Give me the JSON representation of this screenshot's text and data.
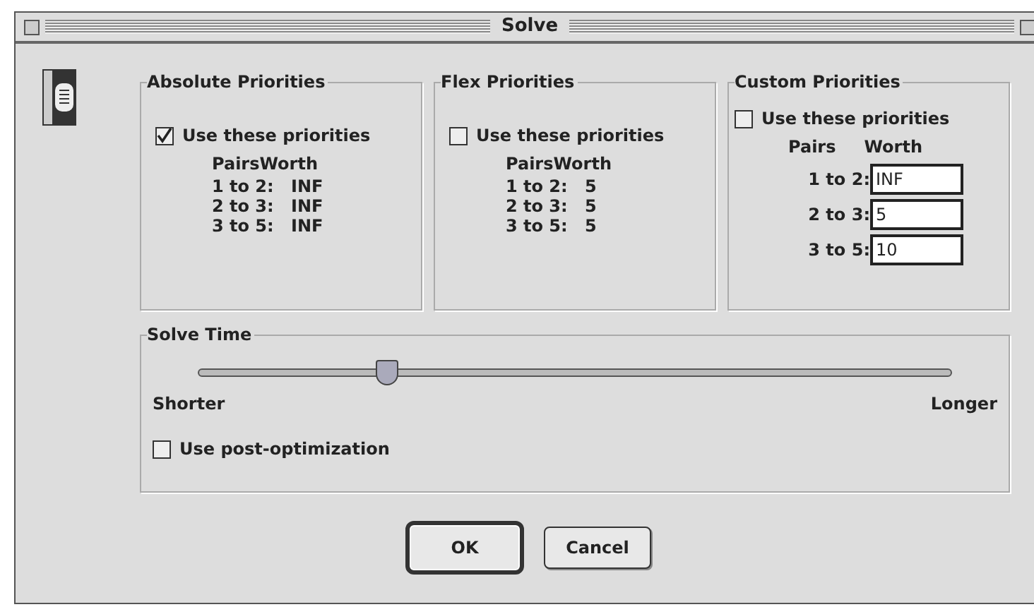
{
  "window": {
    "title": "Solve"
  },
  "groups": [
    {
      "kind": "fixed",
      "title": "Absolute Priorities",
      "use": {
        "label": "Use these priorities",
        "checked": true
      },
      "header": "PairsWorth",
      "rows": [
        {
          "pair": "1 to 2:",
          "worth": "INF"
        },
        {
          "pair": "2 to 3:",
          "worth": "INF"
        },
        {
          "pair": "3 to 5:",
          "worth": "INF"
        }
      ]
    },
    {
      "kind": "fixed",
      "title": "Flex Priorities",
      "use": {
        "label": "Use these priorities",
        "checked": false
      },
      "header": "PairsWorth",
      "rows": [
        {
          "pair": "1 to 2:",
          "worth": "5"
        },
        {
          "pair": "2 to 3:",
          "worth": "5"
        },
        {
          "pair": "3 to 5:",
          "worth": "5"
        }
      ]
    },
    {
      "kind": "custom",
      "title": "Custom Priorities",
      "use": {
        "label": "Use these priorities",
        "checked": false
      },
      "headers": [
        "Pairs",
        "Worth"
      ],
      "rows": [
        {
          "pair": "1 to 2:",
          "worth": "INF"
        },
        {
          "pair": "2 to 3:",
          "worth": "5"
        },
        {
          "pair": "3 to 5:",
          "worth": "10"
        }
      ]
    }
  ],
  "solve_time": {
    "title": "Solve Time",
    "level": 0.25,
    "min_label": "Shorter",
    "max_label": "Longer",
    "post_opt": {
      "label": "Use post-optimization",
      "checked": false
    }
  },
  "buttons": [
    {
      "label": "OK",
      "default": true
    },
    {
      "label": "Cancel",
      "default": false
    }
  ]
}
